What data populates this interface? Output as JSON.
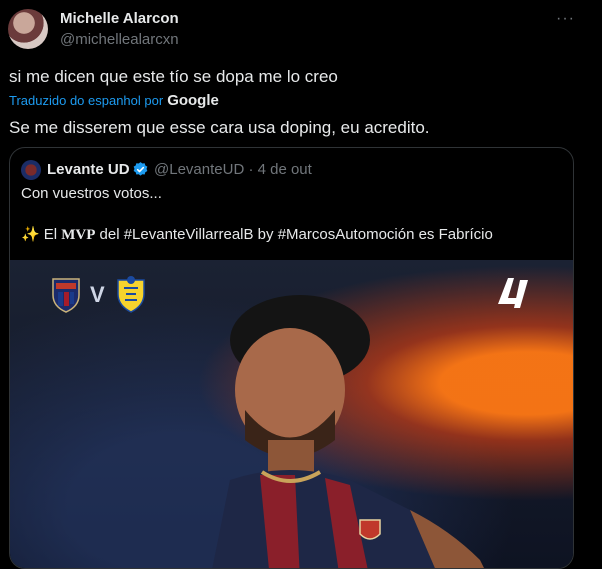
{
  "post": {
    "author_name": "Michelle Alarcon",
    "author_handle": "@michellealarcxn",
    "more_icon": "···",
    "text_original": "si me dicen que este tío se dopa me lo creo",
    "translated_label": "Traduzido do espanhol por",
    "translated_provider": "Google",
    "text_translated": "Se me disserem que esse cara usa doping, eu acredito."
  },
  "quote": {
    "author_name": "Levante UD",
    "author_handle": "@LevanteUD · 4 de out",
    "line1": "Con vuestros votos...",
    "sparkle": "✨",
    "line2_pre": "El ",
    "line2_mvp": "MVP",
    "line2_post": " del #LevanteVillarrealB by #MarcosAutomoción es Fabrício",
    "media": {
      "vs_text": "V"
    }
  },
  "colors": {
    "background": "#000000",
    "text": "#e7e9ea",
    "muted": "#71767b",
    "link": "#1d9bf0",
    "border": "#2f3336"
  }
}
